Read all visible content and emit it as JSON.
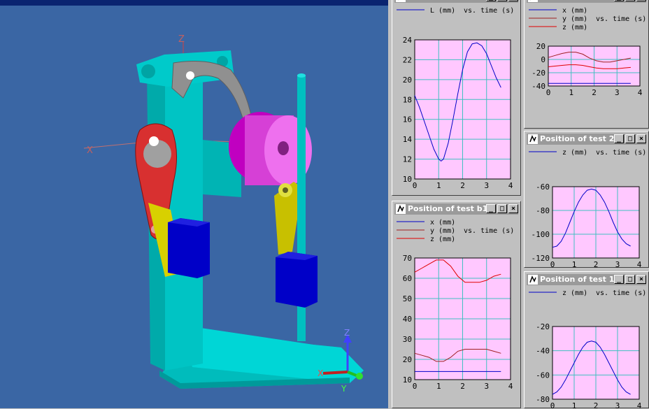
{
  "viewport": {
    "title": ""
  },
  "windows": [
    {
      "id": "w1",
      "title": "",
      "legend": [
        {
          "label": "L (mm)",
          "suffix": "vs. time (s)",
          "color": "#0000c8"
        }
      ]
    },
    {
      "id": "w2",
      "title": "",
      "legend": [
        {
          "label": "x (mm)",
          "suffix": "",
          "color": "#0000c8"
        },
        {
          "label": "y (mm)",
          "suffix": "vs. time (s)",
          "color": "#a02020"
        },
        {
          "label": "z (mm)",
          "suffix": "",
          "color": "#e00000"
        }
      ]
    },
    {
      "id": "w3",
      "title": "Position of test 2",
      "legend": [
        {
          "label": "z (mm)",
          "suffix": "vs. time (s)",
          "color": "#0000c8"
        }
      ]
    },
    {
      "id": "w4",
      "title": "Position of test b1",
      "legend": [
        {
          "label": "x (mm)",
          "suffix": "",
          "color": "#0000c8"
        },
        {
          "label": "y (mm)",
          "suffix": "vs. time (s)",
          "color": "#a02020"
        },
        {
          "label": "z (mm)",
          "suffix": "",
          "color": "#e00000"
        }
      ]
    },
    {
      "id": "w5",
      "title": "Position of test 1",
      "legend": [
        {
          "label": "z (mm)",
          "suffix": "vs. time (s)",
          "color": "#0000c8"
        }
      ]
    }
  ],
  "window_buttons": {
    "minimize": "_",
    "maximize": "□",
    "close": "×"
  },
  "axis_triad": {
    "x": "X",
    "y": "Y",
    "z": "Z"
  },
  "colors": {
    "plot_bg": "#ffc8ff",
    "grid": "#40c0c0",
    "viewport_bg": "#3a66a4"
  },
  "chart_data": [
    {
      "id": "w1",
      "type": "line",
      "xlim": [
        0,
        4
      ],
      "ylim": [
        10,
        24
      ],
      "xticks": [
        0,
        1,
        2,
        3,
        4
      ],
      "yticks": [
        10,
        12,
        14,
        16,
        18,
        20,
        22,
        24
      ],
      "grid": true,
      "series": [
        {
          "name": "L (mm)",
          "color": "#0000c8",
          "x": [
            0,
            0.2,
            0.4,
            0.6,
            0.8,
            1.0,
            1.1,
            1.2,
            1.4,
            1.6,
            1.8,
            2.0,
            2.2,
            2.4,
            2.6,
            2.8,
            3.0,
            3.2,
            3.4,
            3.6
          ],
          "y": [
            18.4,
            17.2,
            15.8,
            14.4,
            13.0,
            12.0,
            11.8,
            12.0,
            13.6,
            16.0,
            18.6,
            21.0,
            22.8,
            23.6,
            23.7,
            23.4,
            22.6,
            21.4,
            20.2,
            19.2
          ]
        }
      ]
    },
    {
      "id": "w2",
      "type": "line",
      "xlim": [
        0,
        4
      ],
      "ylim": [
        -40,
        20
      ],
      "xticks": [
        0,
        1,
        2,
        3,
        4
      ],
      "yticks": [
        -40,
        -20,
        0,
        20
      ],
      "grid": true,
      "series": [
        {
          "name": "x (mm)",
          "color": "#0000c8",
          "x": [
            0,
            3.6
          ],
          "y": [
            -36,
            -36
          ]
        },
        {
          "name": "y (mm)",
          "color": "#a02020",
          "x": [
            0,
            0.3,
            0.6,
            0.9,
            1.2,
            1.5,
            1.8,
            2.1,
            2.4,
            2.7,
            3.0,
            3.3,
            3.6
          ],
          "y": [
            3,
            6,
            9,
            11,
            11,
            8,
            2,
            -2,
            -4,
            -4,
            -2,
            0,
            2
          ]
        },
        {
          "name": "z (mm)",
          "color": "#e00000",
          "x": [
            0,
            0.3,
            0.6,
            0.9,
            1.2,
            1.5,
            1.8,
            2.1,
            2.4,
            2.7,
            3.0,
            3.3,
            3.6
          ],
          "y": [
            -11,
            -10,
            -9,
            -8,
            -8,
            -9,
            -11,
            -13,
            -14,
            -14,
            -14,
            -13,
            -12
          ]
        }
      ]
    },
    {
      "id": "w3",
      "type": "line",
      "xlim": [
        0,
        4
      ],
      "ylim": [
        -120,
        -60
      ],
      "xticks": [
        0,
        1,
        2,
        3,
        4
      ],
      "yticks": [
        -120,
        -100,
        -80,
        -60
      ],
      "grid": true,
      "series": [
        {
          "name": "z (mm)",
          "color": "#0000c8",
          "x": [
            0,
            0.2,
            0.4,
            0.6,
            0.8,
            1.0,
            1.2,
            1.4,
            1.6,
            1.8,
            2.0,
            2.2,
            2.4,
            2.6,
            2.8,
            3.0,
            3.2,
            3.4,
            3.6
          ],
          "y": [
            -111,
            -110,
            -106,
            -99,
            -90,
            -81,
            -73,
            -67,
            -63,
            -62,
            -63,
            -67,
            -73,
            -81,
            -90,
            -98,
            -104,
            -108,
            -110
          ]
        }
      ]
    },
    {
      "id": "w4",
      "type": "line",
      "xlim": [
        0,
        4
      ],
      "ylim": [
        10,
        70
      ],
      "xticks": [
        0,
        1,
        2,
        3,
        4
      ],
      "yticks": [
        10,
        20,
        30,
        40,
        50,
        60,
        70
      ],
      "grid": true,
      "series": [
        {
          "name": "x (mm)",
          "color": "#0000c8",
          "x": [
            0,
            3.6
          ],
          "y": [
            14,
            14
          ]
        },
        {
          "name": "y (mm)",
          "color": "#a02020",
          "x": [
            0,
            0.3,
            0.6,
            0.9,
            1.2,
            1.5,
            1.8,
            2.1,
            2.4,
            2.7,
            3.0,
            3.3,
            3.6
          ],
          "y": [
            23,
            22,
            21,
            19,
            19,
            21,
            24,
            25,
            25,
            25,
            25,
            24,
            23
          ]
        },
        {
          "name": "z (mm)",
          "color": "#e00000",
          "x": [
            0,
            0.3,
            0.6,
            0.9,
            1.2,
            1.5,
            1.8,
            2.1,
            2.4,
            2.7,
            3.0,
            3.3,
            3.6
          ],
          "y": [
            63,
            65,
            67,
            69,
            69,
            66,
            61,
            58,
            58,
            58,
            59,
            61,
            62
          ]
        }
      ]
    },
    {
      "id": "w5",
      "type": "line",
      "xlim": [
        0,
        4
      ],
      "ylim": [
        -80,
        -20
      ],
      "xticks": [
        0,
        1,
        2,
        3,
        4
      ],
      "yticks": [
        -80,
        -60,
        -40,
        -20
      ],
      "grid": true,
      "series": [
        {
          "name": "z (mm)",
          "color": "#0000c8",
          "x": [
            0,
            0.2,
            0.4,
            0.6,
            0.8,
            1.0,
            1.2,
            1.4,
            1.6,
            1.8,
            2.0,
            2.2,
            2.4,
            2.6,
            2.8,
            3.0,
            3.2,
            3.4,
            3.6
          ],
          "y": [
            -76,
            -74,
            -70,
            -64,
            -57,
            -50,
            -43,
            -37,
            -33,
            -32,
            -33,
            -37,
            -43,
            -50,
            -57,
            -64,
            -70,
            -74,
            -76
          ]
        }
      ]
    }
  ]
}
